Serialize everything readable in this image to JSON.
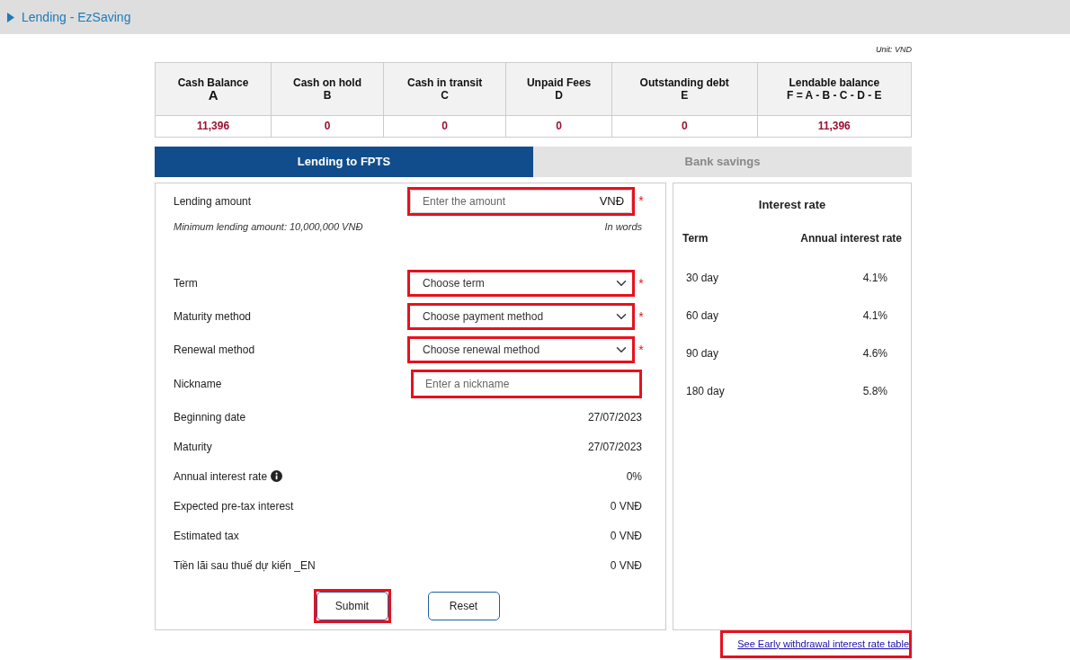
{
  "header": {
    "title": "Lending - EzSaving"
  },
  "unit_note": "Unit: VND",
  "balances": [
    {
      "label": "Cash Balance",
      "letter": "A",
      "value": "11,396"
    },
    {
      "label": "Cash on hold",
      "letter": "B",
      "value": "0"
    },
    {
      "label": "Cash in transit",
      "letter": "C",
      "value": "0"
    },
    {
      "label": "Unpaid Fees",
      "letter": "D",
      "value": "0"
    },
    {
      "label": "Outstanding debt",
      "letter": "E",
      "value": "0"
    },
    {
      "label": "Lendable balance",
      "letter": "F = A - B - C - D - E",
      "value": "11,396"
    }
  ],
  "tabs": [
    {
      "label": "Lending to FPTS",
      "selected": true
    },
    {
      "label": "Bank savings",
      "selected": false
    }
  ],
  "form": {
    "fields": [
      {
        "kind": "amount",
        "label": "Lending amount",
        "placeholder": "Enter the amount",
        "suffix": "VNĐ",
        "required_mark": "*",
        "highlighted": true,
        "hint": "Minimum lending amount: 10,000,000 VNĐ",
        "words_note": "In words"
      },
      {
        "kind": "select",
        "label": "Term",
        "placeholder": "Choose term",
        "required_mark": "*",
        "highlighted": true
      },
      {
        "kind": "select",
        "label": "Maturity method",
        "placeholder": "Choose payment method",
        "required_mark": "*",
        "highlighted": true
      },
      {
        "kind": "select",
        "label": "Renewal method",
        "placeholder": "Choose renewal method",
        "required_mark": "*",
        "highlighted": true
      },
      {
        "kind": "text",
        "label": "Nickname",
        "placeholder": "Enter a nickname",
        "highlighted": true
      }
    ],
    "info_rows": [
      {
        "label": "Beginning date",
        "value": "27/07/2023",
        "info_icon": false
      },
      {
        "label": "Maturity",
        "value": "27/07/2023",
        "info_icon": false
      },
      {
        "label": "Annual interest rate",
        "value": "0%",
        "info_icon": true
      },
      {
        "label": "Expected pre-tax interest",
        "value": "0 VNĐ",
        "info_icon": false
      },
      {
        "label": "Estimated tax",
        "value": "0 VNĐ",
        "info_icon": false
      },
      {
        "label": "Tiền lãi sau thuế dự kiến _EN",
        "value": "0 VNĐ",
        "info_icon": false
      }
    ],
    "buttons": [
      {
        "label": "Submit",
        "highlighted": true
      },
      {
        "label": "Reset",
        "highlighted": false
      }
    ]
  },
  "rates_panel": {
    "title": "Interest rate",
    "columns": [
      "Term",
      "Annual interest rate"
    ],
    "rows": [
      {
        "term": "30 day",
        "rate": "4.1%"
      },
      {
        "term": "60 day",
        "rate": "4.1%"
      },
      {
        "term": "90 day",
        "rate": "4.6%"
      },
      {
        "term": "180 day",
        "rate": "5.8%"
      }
    ]
  },
  "footer_link": {
    "label": "See Early withdrawal interest rate table",
    "highlighted": true
  }
}
